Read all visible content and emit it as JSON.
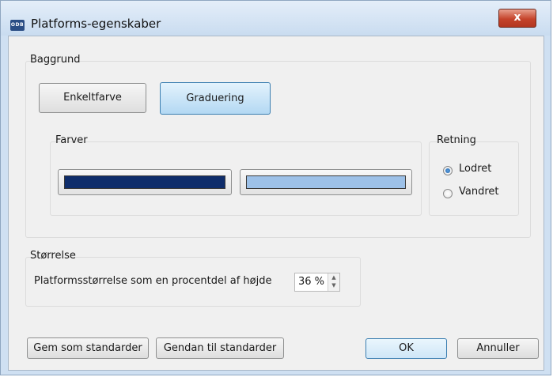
{
  "window": {
    "title": "Platforms-egenskaber",
    "app_icon_text": "ODB",
    "close_glyph": "x"
  },
  "background_group": {
    "label": "Baggrund",
    "single_color_label": "Enkeltfarve",
    "gradient_label": "Graduering",
    "selected_mode": "Graduering"
  },
  "colors_group": {
    "label": "Farver",
    "color1": "#0f2d6b",
    "color2": "#9dc1e8"
  },
  "direction_group": {
    "label": "Retning",
    "options": [
      {
        "label": "Lodret",
        "checked": true
      },
      {
        "label": "Vandret",
        "checked": false
      }
    ]
  },
  "size_group": {
    "label": "Størrelse",
    "description": "Platformsstørrelse som en procentdel af højde",
    "value": "36 %"
  },
  "footer": {
    "save_default_label": "Gem som standarder",
    "restore_default_label": "Gendan til standarder",
    "ok_label": "OK",
    "cancel_label": "Annuller"
  }
}
